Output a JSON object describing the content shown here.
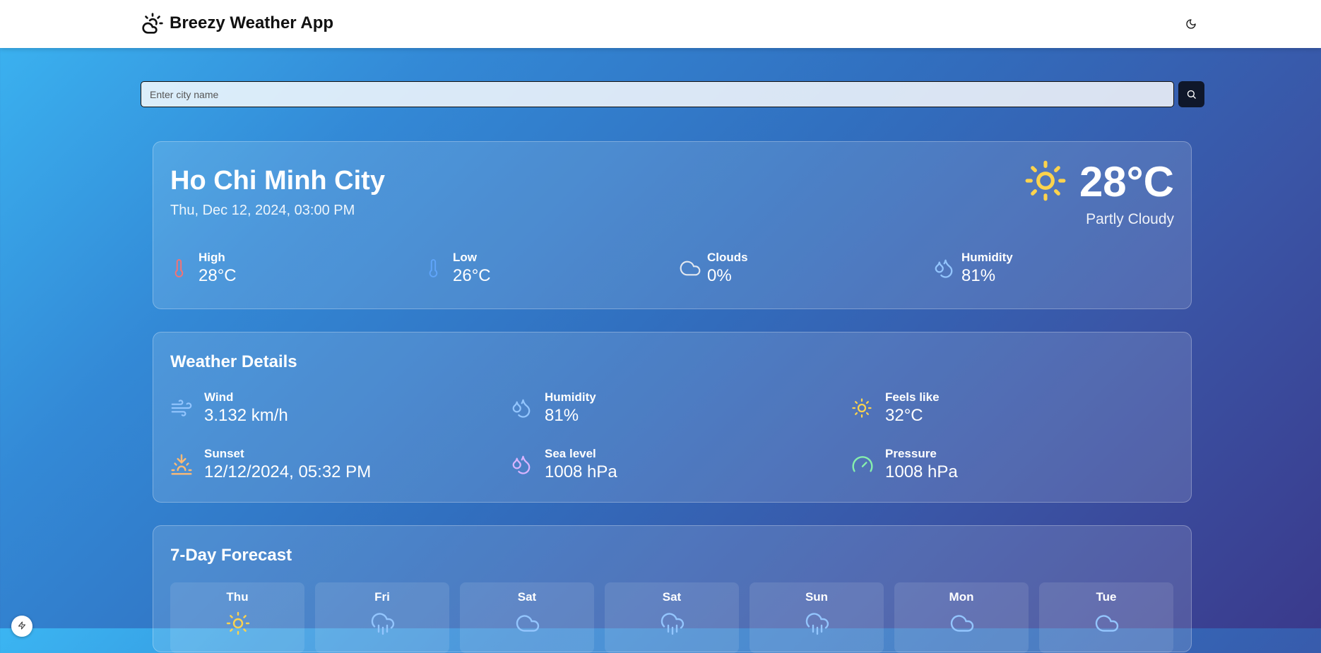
{
  "app": {
    "title": "Breezy Weather App"
  },
  "search": {
    "placeholder": "Enter city name"
  },
  "current": {
    "city": "Ho Chi Minh City",
    "datetime": "Thu, Dec 12, 2024, 03:00 PM",
    "temperature": "28°C",
    "condition": "Partly Cloudy",
    "stats": [
      {
        "label": "High",
        "value": "28°C",
        "icon": "thermometer-icon"
      },
      {
        "label": "Low",
        "value": "26°C",
        "icon": "thermometer-icon"
      },
      {
        "label": "Clouds",
        "value": "0%",
        "icon": "cloud-icon"
      },
      {
        "label": "Humidity",
        "value": "81%",
        "icon": "droplets-icon"
      }
    ]
  },
  "details": {
    "title": "Weather Details",
    "items": [
      {
        "label": "Wind",
        "value": "3.132 km/h",
        "icon": "wind-icon"
      },
      {
        "label": "Humidity",
        "value": "81%",
        "icon": "droplets-icon"
      },
      {
        "label": "Feels like",
        "value": "32°C",
        "icon": "sun-icon"
      },
      {
        "label": "Sunset",
        "value": "12/12/2024, 05:32 PM",
        "icon": "sunset-icon"
      },
      {
        "label": "Sea level",
        "value": "1008 hPa",
        "icon": "droplets-icon"
      },
      {
        "label": "Pressure",
        "value": "1008 hPa",
        "icon": "gauge-icon"
      }
    ]
  },
  "forecast": {
    "title": "7-Day Forecast",
    "days": [
      {
        "day": "Thu",
        "icon": "sun-icon"
      },
      {
        "day": "Fri",
        "icon": "cloud-rain-icon"
      },
      {
        "day": "Sat",
        "icon": "cloud-icon"
      },
      {
        "day": "Sat",
        "icon": "cloud-rain-icon"
      },
      {
        "day": "Sun",
        "icon": "cloud-rain-icon"
      },
      {
        "day": "Mon",
        "icon": "cloud-icon"
      },
      {
        "day": "Tue",
        "icon": "cloud-icon"
      }
    ]
  },
  "colors": {
    "sun": "#fcd34d",
    "high_temp": "#f87171",
    "low_temp": "#60a5fa",
    "humidity": "#93c5fd",
    "sea_level": "#d8b4fe",
    "pressure": "#86efac",
    "sunset": "#fdba74",
    "wind": "#93c5fd"
  }
}
